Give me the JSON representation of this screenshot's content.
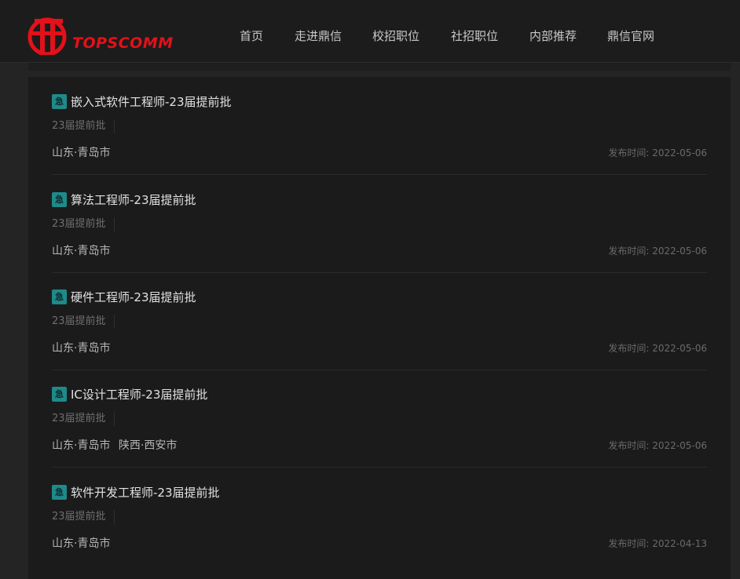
{
  "brand": {
    "logo_text": "TOPSCOMM",
    "accent": "#e3111a"
  },
  "nav": [
    {
      "label": "首页"
    },
    {
      "label": "走进鼎信"
    },
    {
      "label": "校招职位"
    },
    {
      "label": "社招职位"
    },
    {
      "label": "内部推荐"
    },
    {
      "label": "鼎信官网"
    }
  ],
  "jobs": [
    {
      "title": "嵌入式软件工程师-23届提前批",
      "tag": "23届提前批",
      "locations": [
        "山东·青岛市"
      ],
      "date_label": "发布时间:",
      "date": "2022-05-06",
      "icon": "urgent-icon"
    },
    {
      "title": "算法工程师-23届提前批",
      "tag": "23届提前批",
      "locations": [
        "山东·青岛市"
      ],
      "date_label": "发布时间:",
      "date": "2022-05-06",
      "icon": "urgent-icon"
    },
    {
      "title": "硬件工程师-23届提前批",
      "tag": "23届提前批",
      "locations": [
        "山东·青岛市"
      ],
      "date_label": "发布时间:",
      "date": "2022-05-06",
      "icon": "urgent-icon"
    },
    {
      "title": "IC设计工程师-23届提前批",
      "tag": "23届提前批",
      "locations": [
        "山东·青岛市",
        "陕西·西安市"
      ],
      "date_label": "发布时间:",
      "date": "2022-05-06",
      "icon": "urgent-icon"
    },
    {
      "title": "软件开发工程师-23届提前批",
      "tag": "23届提前批",
      "locations": [
        "山东·青岛市"
      ],
      "date_label": "发布时间:",
      "date": "2022-04-13",
      "icon": "urgent-icon"
    }
  ],
  "urgent_badge": "急"
}
